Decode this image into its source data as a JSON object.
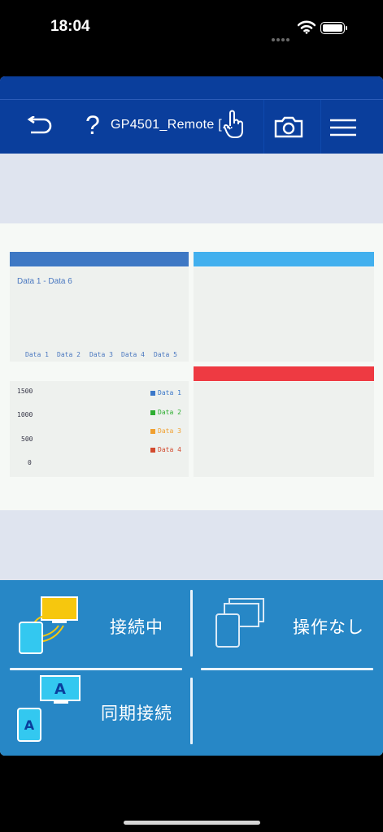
{
  "status_bar": {
    "time": "18:04"
  },
  "toolbar": {
    "title": "GP4501_Remote [..."
  },
  "screen": {
    "bar_chart": {
      "caption": "Data 1 - Data 6",
      "categories": [
        "Data 1",
        "Data 2",
        "Data 3",
        "Data 4",
        "Data 5"
      ]
    },
    "line_chart": {
      "yticks": [
        "1500",
        "1000",
        "500",
        "0"
      ],
      "legend": [
        {
          "label": "Data 1",
          "color": "#3b78c9"
        },
        {
          "label": "Data 2",
          "color": "#2fae32"
        },
        {
          "label": "Data 3",
          "color": "#f0a030"
        },
        {
          "label": "Data 4",
          "color": "#d24a2e"
        }
      ]
    },
    "colors": {
      "header_blue": "#3e78c4",
      "header_cyan": "#42b0ee",
      "header_red": "#ee3a42"
    }
  },
  "bottom_panel": {
    "connected_label": "接続中",
    "no_operation_label": "操作なし",
    "sync_connect_label": "同期接続"
  }
}
